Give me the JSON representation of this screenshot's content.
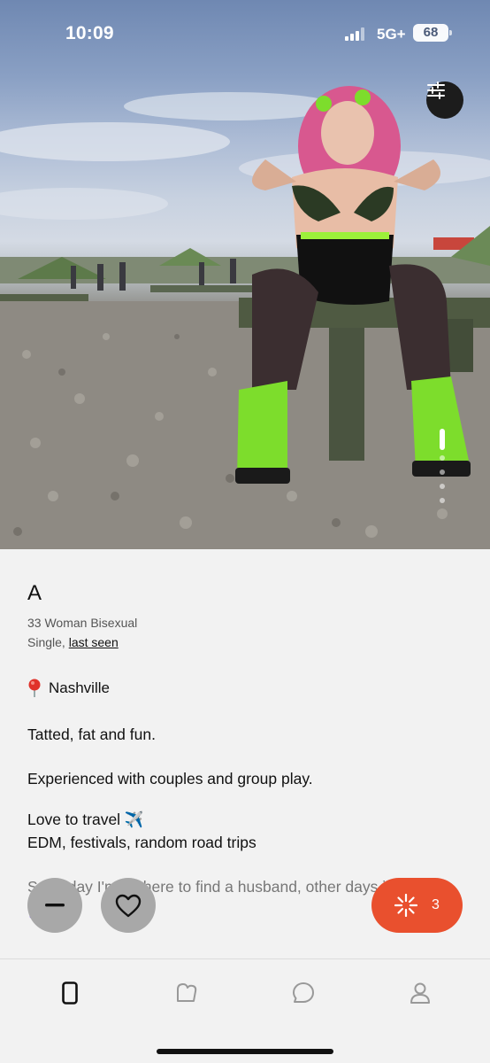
{
  "status_bar": {
    "time": "10:09",
    "network": "5G+",
    "battery": "68"
  },
  "photo": {
    "filter_icon": "sliders-icon",
    "pager_count": 5,
    "pager_active": 1
  },
  "profile": {
    "name": "A",
    "details": "33 Woman Bisexual",
    "status_prefix": "Single, ",
    "last_seen": "last seen",
    "location": "Nashville",
    "bio": {
      "p1": "Tatted, fat and fun.",
      "p2": "Experienced with couples and group play.",
      "p3_line1": "Love to travel ✈️",
      "p3_line2": "EDM, festivals, random road trips",
      "p4": "Someday I'm on here to find a husband, other days just vibing 🤷‍♀️"
    }
  },
  "actions": {
    "pass_icon": "minus-icon",
    "like_icon": "heart-icon",
    "spark_icon": "spark-icon",
    "spark_count": "3",
    "spark_color": "#e9502e"
  },
  "tabs": [
    {
      "icon": "phone-card-icon",
      "active": true
    },
    {
      "icon": "likes-bubble-icon",
      "active": false
    },
    {
      "icon": "chat-icon",
      "active": false
    },
    {
      "icon": "profile-icon",
      "active": false
    }
  ]
}
